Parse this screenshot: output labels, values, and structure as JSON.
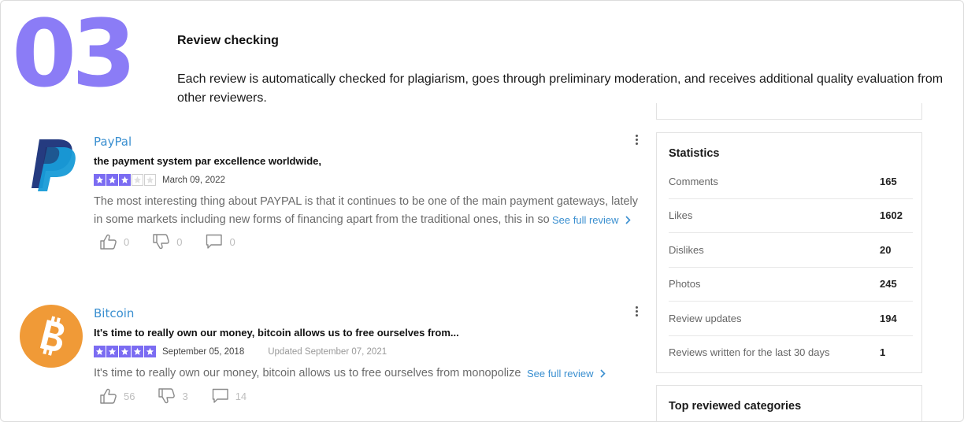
{
  "step": {
    "number": "03",
    "title": "Review checking",
    "description": "Each review is automatically checked for plagiarism, goes through preliminary moderation, and receives additional quality evaluation from other reviewers."
  },
  "reviews": [
    {
      "brand": "PayPal",
      "headline": "the payment system par excellence worldwide,",
      "rating": 3,
      "max_rating": 5,
      "date": "March 09, 2022",
      "updated": "",
      "text_line1": "The most interesting thing about PAYPAL is that it continues to be one of the main payment gateways, lately",
      "text_line2": "in some markets including new forms of financing apart from the traditional ones, this in so",
      "see_full": "See full review",
      "likes": "0",
      "dislikes": "0",
      "comments": "0",
      "logo_icon": "paypal-logo"
    },
    {
      "brand": "Bitcoin",
      "headline": "It's time to really own our money, bitcoin allows us to free ourselves from...",
      "rating": 5,
      "max_rating": 5,
      "date": "September 05, 2018",
      "updated": "Updated September 07, 2021",
      "text_line1": "It's time to really own our money, bitcoin allows us to free ourselves from monopolize",
      "see_full": "See full review",
      "likes": "56",
      "dislikes": "3",
      "comments": "14",
      "logo_icon": "bitcoin-logo"
    }
  ],
  "statistics": {
    "title": "Statistics",
    "rows": [
      {
        "label": "Comments",
        "value": "165"
      },
      {
        "label": "Likes",
        "value": "1602"
      },
      {
        "label": "Dislikes",
        "value": "20"
      },
      {
        "label": "Photos",
        "value": "245"
      },
      {
        "label": "Review updates",
        "value": "194"
      },
      {
        "label": "Reviews written for the last 30 days",
        "value": "1"
      }
    ]
  },
  "top_categories": {
    "title": "Top reviewed categories"
  },
  "colors": {
    "accent": "#8b7cf6",
    "star": "#7b6cf2",
    "link": "#3a8fd0",
    "bitcoin": "#f09a37",
    "paypal_dark": "#253b80",
    "paypal_light": "#179bd7"
  },
  "icons": {
    "like": "thumbs-up-icon",
    "dislike": "thumbs-down-icon",
    "comment": "comment-icon",
    "more": "more-vertical-icon",
    "chevron": "chevron-right-icon",
    "star": "star-icon"
  }
}
